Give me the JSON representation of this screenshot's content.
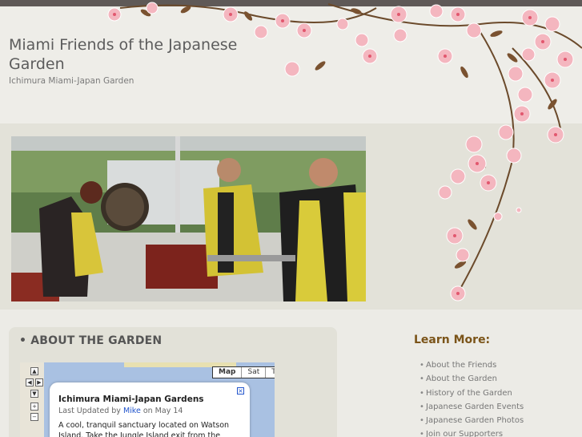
{
  "site": {
    "title": "Miami Friends of the Japanese Garden",
    "tagline": "Ichimura Miami-Japan Garden"
  },
  "about": {
    "heading": "• ABOUT THE GARDEN"
  },
  "map": {
    "type_buttons": [
      "Map",
      "Sat",
      "Ter"
    ],
    "selected_type": "Map",
    "controls": [
      "pan-up-icon",
      "pan-left-icon",
      "pan-right-icon",
      "pan-down-icon",
      "zoom-in-icon",
      "zoom-out-icon"
    ],
    "info_window": {
      "title": "Ichimura Miami-Japan Gardens",
      "meta_prefix": "Last Updated by",
      "author": "Mike",
      "meta_suffix": "on May 14",
      "description": "A cool, tranquil sanctuary located on Watson Island. Take the Jungle Island exit from the"
    }
  },
  "sidebar": {
    "heading": "Learn More:",
    "links": [
      "About the Friends",
      "About the Garden",
      "History of the Garden",
      "Japanese Garden Events",
      "Japanese Garden Photos",
      "Join our Supporters"
    ]
  },
  "colors": {
    "topbar": "#5f5957",
    "background": "#ecebe6",
    "band": "#e3e2d9",
    "blossom": "#f4b6bf",
    "branch": "#6b4a2b",
    "learn_heading": "#7b5419",
    "link": "#2255cc"
  }
}
